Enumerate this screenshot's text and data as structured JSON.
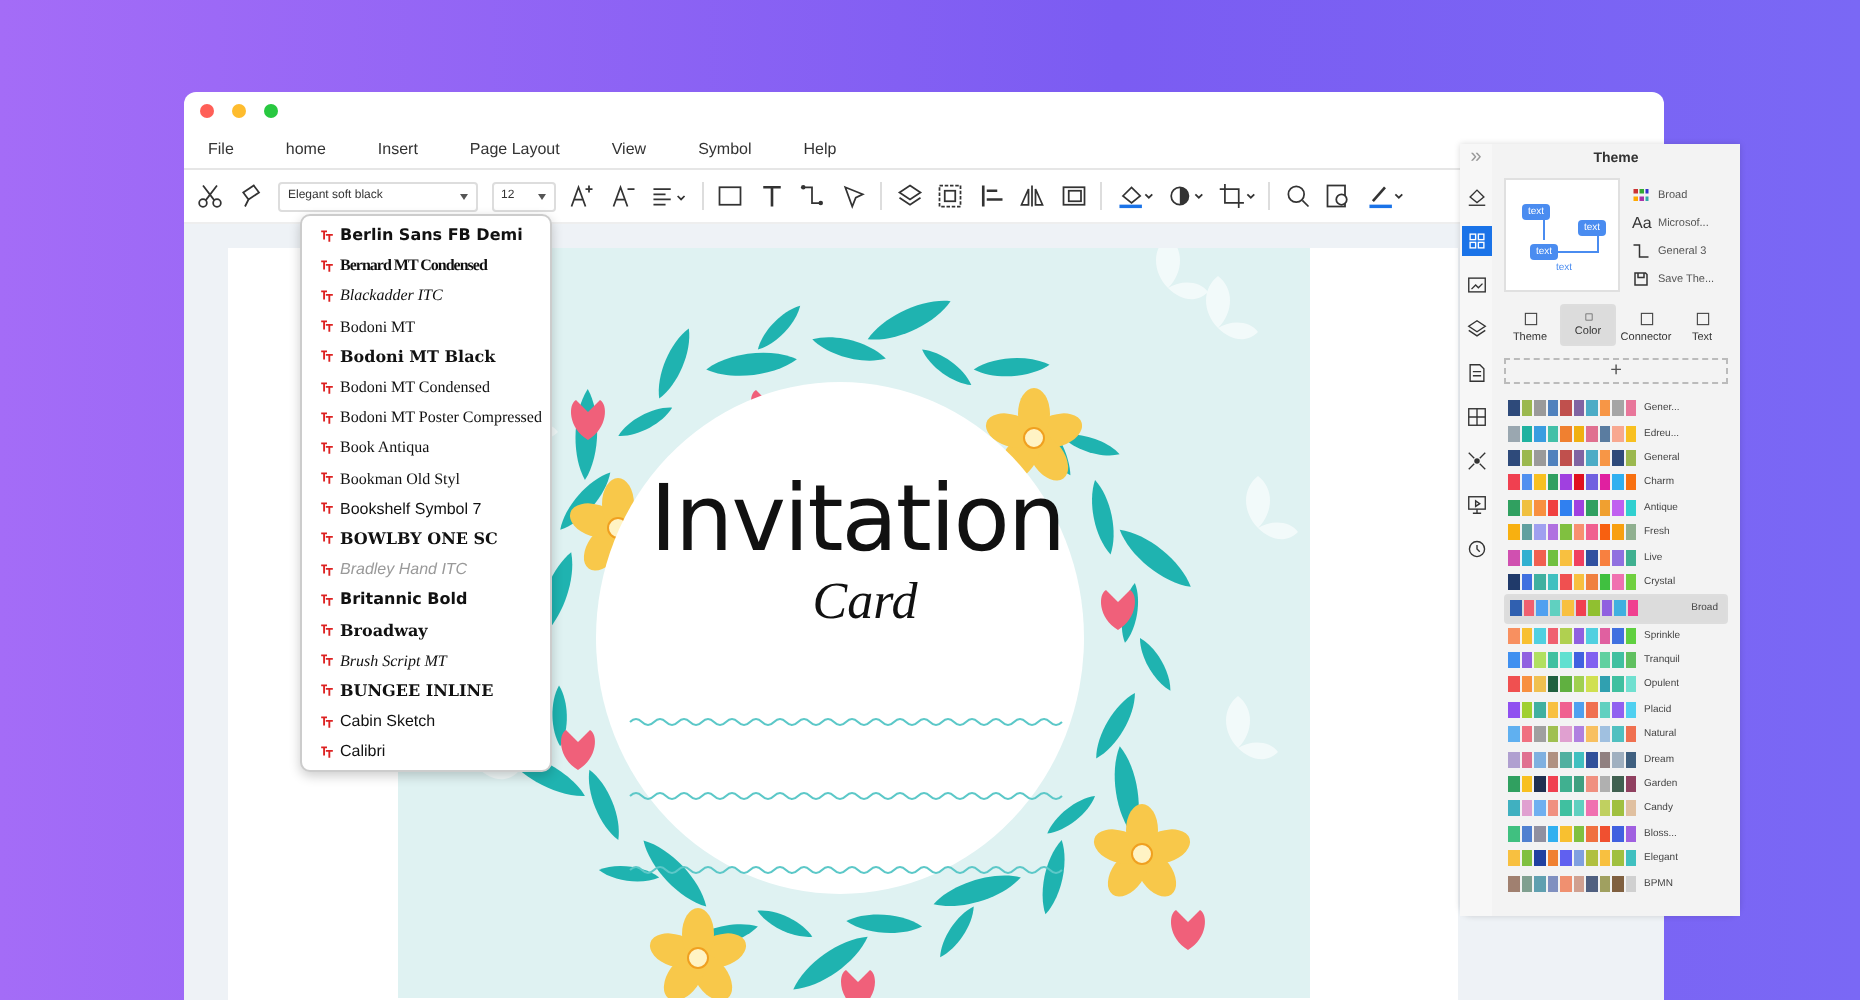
{
  "window": {
    "controls": [
      {
        "color": "#ff5f57"
      },
      {
        "color": "#febc2e"
      },
      {
        "color": "#28c840"
      }
    ]
  },
  "menu": [
    "File",
    "home",
    "Insert",
    "Page Layout",
    "View",
    "Symbol",
    "Help"
  ],
  "toolbar": {
    "font": "Elegant soft black",
    "size": "12"
  },
  "font_menu": [
    {
      "label": "Berlin Sans FB Demi",
      "kind": "bold"
    },
    {
      "label": "Bernard MT Condensed",
      "kind": "condensed"
    },
    {
      "label": "Blackadder ITC",
      "kind": "script"
    },
    {
      "label": "Bodoni MT",
      "kind": "serif"
    },
    {
      "label": "Bodoni MT Black",
      "kind": "black"
    },
    {
      "label": "Bodoni MT Condensed",
      "kind": "narrow"
    },
    {
      "label": "Bodoni MT Poster Compressed",
      "kind": "narrow"
    },
    {
      "label": "Book Antiqua",
      "kind": "serif"
    },
    {
      "label": "Bookman Old Styl",
      "kind": "serif"
    },
    {
      "label": "Bookshelf Symbol 7",
      "kind": "regular"
    },
    {
      "label": "BOWLBY ONE SC",
      "kind": "black"
    },
    {
      "label": "Bradley Hand ITC",
      "kind": "light"
    },
    {
      "label": "Britannic Bold",
      "kind": "bold"
    },
    {
      "label": "Broadway",
      "kind": "black"
    },
    {
      "label": "Brush Script MT",
      "kind": "script"
    },
    {
      "label": "BUNGEE INLINE",
      "kind": "black"
    },
    {
      "label": "Cabin Sketch",
      "kind": "regular"
    },
    {
      "label": "Calibri",
      "kind": "regular"
    }
  ],
  "card": {
    "title": "Invitation",
    "subtitle": "Card"
  },
  "panel": {
    "title": "Theme",
    "collapse": "»",
    "preview": {
      "labels": [
        "text",
        "text",
        "text",
        "text"
      ]
    },
    "options": [
      {
        "label": "Broad"
      },
      {
        "label": "Microsof...",
        "glyph": "Aa"
      },
      {
        "label": "General 3"
      },
      {
        "label": "Save The..."
      }
    ],
    "tabs": [
      {
        "label": "Theme",
        "selected": false
      },
      {
        "label": "Color",
        "selected": true
      },
      {
        "label": "Connector",
        "selected": false
      },
      {
        "label": "Text",
        "selected": false
      }
    ],
    "add_label": "+",
    "themes": [
      {
        "name": "Gener...",
        "selected": false,
        "swatches": [
          {
            "color": "#2e4a7a"
          },
          {
            "color": "#9bb84e"
          },
          {
            "color": "#9a9a9a"
          },
          {
            "color": "#4f81bd"
          },
          {
            "color": "#c0504d"
          },
          {
            "color": "#8064a2"
          },
          {
            "color": "#4bacc6"
          },
          {
            "color": "#f79646"
          },
          {
            "color": "#a5a5a5"
          },
          {
            "color": "#e8769a"
          }
        ]
      },
      {
        "name": "Edreu...",
        "selected": false,
        "swatches": [
          {
            "color": "#9aa7b0"
          },
          {
            "color": "#20b2a0"
          },
          {
            "color": "#3a9de0"
          },
          {
            "color": "#43c0a8"
          },
          {
            "color": "#f08030"
          },
          {
            "color": "#f0b010"
          },
          {
            "color": "#e07090"
          },
          {
            "color": "#5a7ca0"
          },
          {
            "color": "#f8a890"
          },
          {
            "color": "#f8c020"
          }
        ]
      },
      {
        "name": "General",
        "selected": false,
        "swatches": [
          {
            "color": "#2e4a7a"
          },
          {
            "color": "#9bb84e"
          },
          {
            "color": "#9a9a9a"
          },
          {
            "color": "#4f81bd"
          },
          {
            "color": "#c0504d"
          },
          {
            "color": "#8064a2"
          },
          {
            "color": "#4bacc6"
          },
          {
            "color": "#f79646"
          },
          {
            "color": "#2e4a7a"
          },
          {
            "color": "#9bb84e"
          }
        ]
      },
      {
        "name": "Charm",
        "selected": false,
        "swatches": [
          {
            "color": "#f04050"
          },
          {
            "color": "#5090f0"
          },
          {
            "color": "#f8c020"
          },
          {
            "color": "#30a060"
          },
          {
            "color": "#a040e0"
          },
          {
            "color": "#e01020"
          },
          {
            "color": "#7060e0"
          },
          {
            "color": "#e020a0"
          },
          {
            "color": "#30b0f0"
          },
          {
            "color": "#f87010"
          }
        ]
      },
      {
        "name": "Antique",
        "selected": false,
        "swatches": [
          {
            "color": "#30a060"
          },
          {
            "color": "#f0c040"
          },
          {
            "color": "#f89040"
          },
          {
            "color": "#f04040"
          },
          {
            "color": "#3080f0"
          },
          {
            "color": "#a040e0"
          },
          {
            "color": "#30a060"
          },
          {
            "color": "#f0a030"
          },
          {
            "color": "#c060f0"
          },
          {
            "color": "#30d0d0"
          }
        ]
      },
      {
        "name": "Fresh",
        "selected": false,
        "swatches": [
          {
            "color": "#f8b010"
          },
          {
            "color": "#60a0a0"
          },
          {
            "color": "#a0a0f0"
          },
          {
            "color": "#b070e0"
          },
          {
            "color": "#80c040"
          },
          {
            "color": "#f89070"
          },
          {
            "color": "#f06090"
          },
          {
            "color": "#f86010"
          },
          {
            "color": "#f8a010"
          },
          {
            "color": "#90b090"
          }
        ]
      },
      {
        "name": "Live",
        "selected": false,
        "swatches": [
          {
            "color": "#d050b0"
          },
          {
            "color": "#30b0d0"
          },
          {
            "color": "#f06050"
          },
          {
            "color": "#70c040"
          },
          {
            "color": "#f8c040"
          },
          {
            "color": "#f04060"
          },
          {
            "color": "#3050a0"
          },
          {
            "color": "#f88040"
          },
          {
            "color": "#9070e0"
          },
          {
            "color": "#40b090"
          }
        ]
      },
      {
        "name": "Crystal",
        "selected": false,
        "swatches": [
          {
            "color": "#203a6a"
          },
          {
            "color": "#4070e0"
          },
          {
            "color": "#40b0a0"
          },
          {
            "color": "#40c0c0"
          },
          {
            "color": "#f05050"
          },
          {
            "color": "#f8c040"
          },
          {
            "color": "#f08040"
          },
          {
            "color": "#40c040"
          },
          {
            "color": "#f070b0"
          },
          {
            "color": "#70d040"
          }
        ]
      },
      {
        "name": "Broad",
        "selected": true,
        "swatches": [
          {
            "color": "#3060b0"
          },
          {
            "color": "#f06070"
          },
          {
            "color": "#50a0f0"
          },
          {
            "color": "#60d0c0"
          },
          {
            "color": "#f8c040"
          },
          {
            "color": "#f04050"
          },
          {
            "color": "#90c030"
          },
          {
            "color": "#9060e0"
          },
          {
            "color": "#40b0e0"
          },
          {
            "color": "#f04090"
          }
        ]
      },
      {
        "name": "Sprinkle",
        "selected": false,
        "swatches": [
          {
            "color": "#f89060"
          },
          {
            "color": "#f8c030"
          },
          {
            "color": "#50d0e0"
          },
          {
            "color": "#f06070"
          },
          {
            "color": "#b0d050"
          },
          {
            "color": "#9060e0"
          },
          {
            "color": "#50d0e0"
          },
          {
            "color": "#e060a0"
          },
          {
            "color": "#4070e0"
          },
          {
            "color": "#60d040"
          }
        ]
      },
      {
        "name": "Tranquil",
        "selected": false,
        "swatches": [
          {
            "color": "#4090f0"
          },
          {
            "color": "#9060e0"
          },
          {
            "color": "#b0e060"
          },
          {
            "color": "#40c0a0"
          },
          {
            "color": "#60e0d0"
          },
          {
            "color": "#4060e0"
          },
          {
            "color": "#8060f0"
          },
          {
            "color": "#60d0a0"
          },
          {
            "color": "#40c0a0"
          },
          {
            "color": "#60c060"
          }
        ]
      },
      {
        "name": "Opulent",
        "selected": false,
        "swatches": [
          {
            "color": "#f05050"
          },
          {
            "color": "#f89040"
          },
          {
            "color": "#f0c050"
          },
          {
            "color": "#206040"
          },
          {
            "color": "#60b040"
          },
          {
            "color": "#a0d050"
          },
          {
            "color": "#d0e050"
          },
          {
            "color": "#30a0b0"
          },
          {
            "color": "#40c0a0"
          },
          {
            "color": "#70e0d0"
          }
        ]
      },
      {
        "name": "Placid",
        "selected": false,
        "swatches": [
          {
            "color": "#9050f0"
          },
          {
            "color": "#a0d030"
          },
          {
            "color": "#40b0a0"
          },
          {
            "color": "#f8c040"
          },
          {
            "color": "#f06090"
          },
          {
            "color": "#50a0f0"
          },
          {
            "color": "#f07050"
          },
          {
            "color": "#60d0c0"
          },
          {
            "color": "#9060f0"
          },
          {
            "color": "#50d0f0"
          }
        ]
      },
      {
        "name": "Natural",
        "selected": false,
        "swatches": [
          {
            "color": "#60b0f0"
          },
          {
            "color": "#f07080"
          },
          {
            "color": "#a0a0a0"
          },
          {
            "color": "#a0c050"
          },
          {
            "color": "#e0a0d0"
          },
          {
            "color": "#b080e0"
          },
          {
            "color": "#f8c060"
          },
          {
            "color": "#a0c0e0"
          },
          {
            "color": "#50c0c0"
          },
          {
            "color": "#f07050"
          }
        ]
      },
      {
        "name": "Dream",
        "selected": false,
        "swatches": [
          {
            "color": "#b0a0d0"
          },
          {
            "color": "#e07090"
          },
          {
            "color": "#80b0e0"
          },
          {
            "color": "#b09080"
          },
          {
            "color": "#50b0a0"
          },
          {
            "color": "#40c0c0"
          },
          {
            "color": "#30509a"
          },
          {
            "color": "#908080"
          },
          {
            "color": "#a0b0c0"
          },
          {
            "color": "#406080"
          }
        ]
      },
      {
        "name": "Garden",
        "selected": false,
        "swatches": [
          {
            "color": "#30a060"
          },
          {
            "color": "#f8c020"
          },
          {
            "color": "#203050"
          },
          {
            "color": "#f04050"
          },
          {
            "color": "#40b090"
          },
          {
            "color": "#40a080"
          },
          {
            "color": "#f09080"
          },
          {
            "color": "#b0b0b0"
          },
          {
            "color": "#406050"
          },
          {
            "color": "#904060"
          }
        ]
      },
      {
        "name": "Candy",
        "selected": false,
        "swatches": [
          {
            "color": "#40b0c0"
          },
          {
            "color": "#e0a0d0"
          },
          {
            "color": "#70b0f0"
          },
          {
            "color": "#f09080"
          },
          {
            "color": "#40c0a0"
          },
          {
            "color": "#60d0c0"
          },
          {
            "color": "#f070b0"
          },
          {
            "color": "#c0d060"
          },
          {
            "color": "#a0c040"
          },
          {
            "color": "#e0c0a0"
          }
        ]
      },
      {
        "name": "Bloss...",
        "selected": false,
        "swatches": [
          {
            "color": "#40c080"
          },
          {
            "color": "#5080d0"
          },
          {
            "color": "#9090a0"
          },
          {
            "color": "#30b0f0"
          },
          {
            "color": "#f8c030"
          },
          {
            "color": "#80c040"
          },
          {
            "color": "#f07040"
          },
          {
            "color": "#f05030"
          },
          {
            "color": "#4060e0"
          },
          {
            "color": "#a060e0"
          }
        ]
      },
      {
        "name": "Elegant",
        "selected": false,
        "swatches": [
          {
            "color": "#f8c040"
          },
          {
            "color": "#80c040"
          },
          {
            "color": "#2040a0"
          },
          {
            "color": "#f08030"
          },
          {
            "color": "#6060f0"
          },
          {
            "color": "#80a0e0"
          },
          {
            "color": "#b0c040"
          },
          {
            "color": "#f8c040"
          },
          {
            "color": "#a0c040"
          },
          {
            "color": "#40c0c0"
          }
        ]
      },
      {
        "name": "BPMN",
        "selected": false,
        "swatches": [
          {
            "color": "#a08070"
          },
          {
            "color": "#80a090"
          },
          {
            "color": "#60a0b0"
          },
          {
            "color": "#8090c0"
          },
          {
            "color": "#f09070"
          },
          {
            "color": "#d0a090"
          },
          {
            "color": "#506080"
          },
          {
            "color": "#a0a060"
          },
          {
            "color": "#806040"
          },
          {
            "color": "#d0d0d0"
          }
        ]
      }
    ]
  }
}
